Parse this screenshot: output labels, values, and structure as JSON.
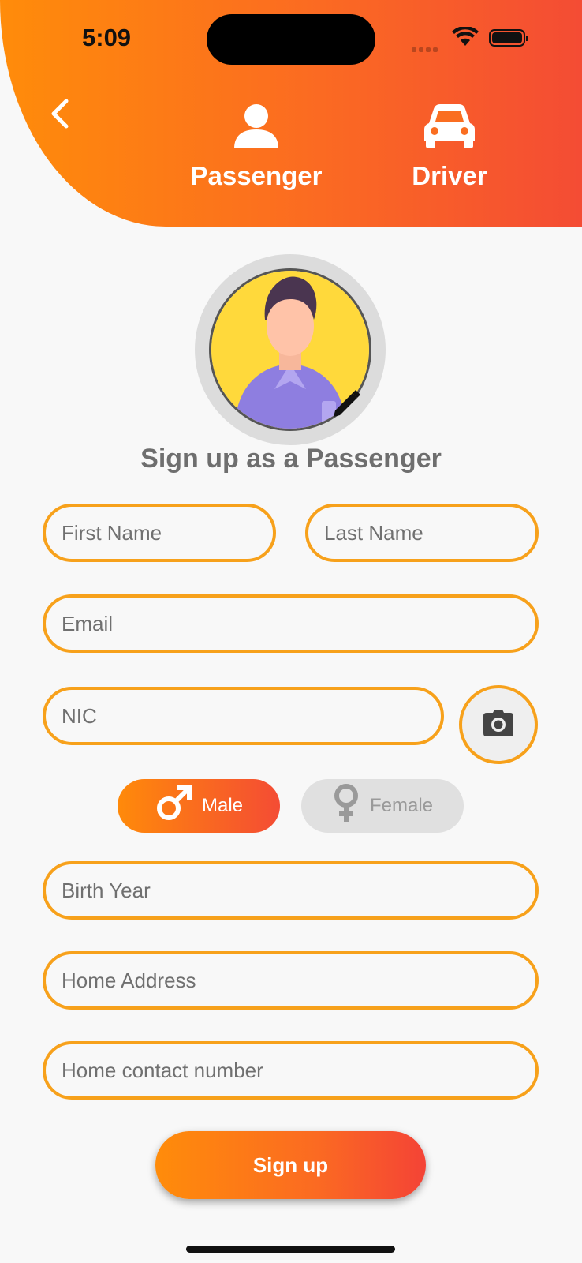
{
  "status_bar": {
    "time": "5:09"
  },
  "header": {
    "roles": [
      {
        "label": "Passenger",
        "icon": "person-icon"
      },
      {
        "label": "Driver",
        "icon": "car-icon"
      }
    ]
  },
  "avatar": {
    "icon": "avatar-illustration",
    "edit_icon": "pencil-icon"
  },
  "form": {
    "title": "Sign up as a Passenger",
    "first_name_placeholder": "First Name",
    "last_name_placeholder": "Last Name",
    "email_placeholder": "Email",
    "nic_placeholder": "NIC",
    "camera_icon": "camera-icon",
    "gender": {
      "options": [
        {
          "label": "Male",
          "icon": "male-symbol-icon",
          "selected": true
        },
        {
          "label": "Female",
          "icon": "female-symbol-icon",
          "selected": false
        }
      ]
    },
    "birth_year_placeholder": "Birth Year",
    "home_address_placeholder": "Home Address",
    "home_contact_placeholder": "Home contact number",
    "submit_label": "Sign up"
  },
  "colors": {
    "accent_orange": "#ff8c0a",
    "accent_red": "#f44c34",
    "field_border": "#f7a11b",
    "title_gray": "#6e6e6e"
  }
}
